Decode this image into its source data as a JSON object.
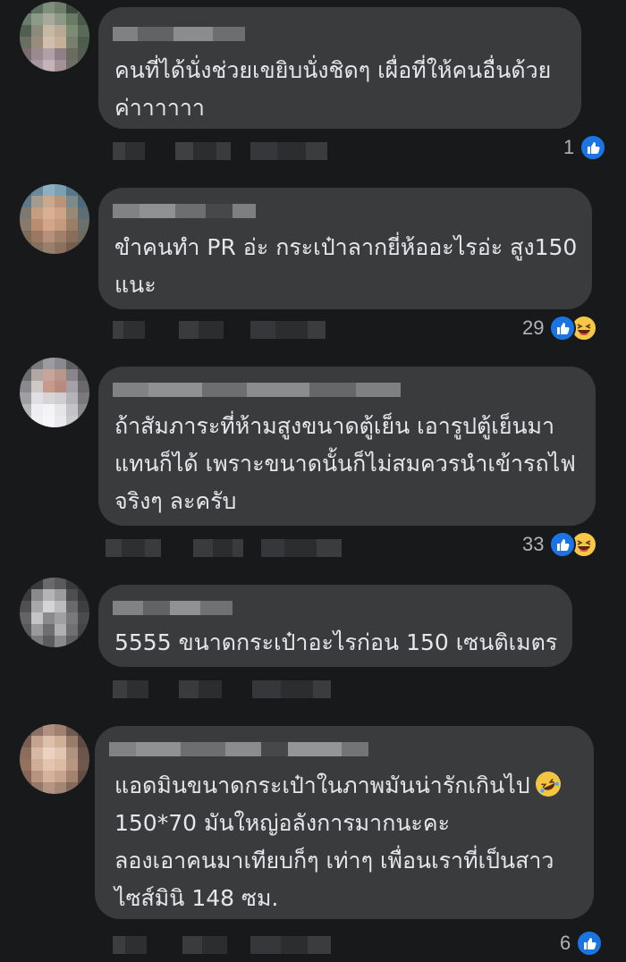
{
  "comments": [
    {
      "text": "คนที่ได้นั่งช่วยเขยิบนั่งชิดๆ เผื่อที่ให้คนอื่นด้วย\nค่าาาาาา",
      "reactions": "1",
      "reaction_icons": [
        "like-icon"
      ]
    },
    {
      "text": "ขำคนทำ PR อ่ะ กระเป๋าลากยี่ห้ออะไรอ่ะ สูง150\nแนะ",
      "reactions": "29",
      "reaction_icons": [
        "like-icon",
        "haha-icon"
      ]
    },
    {
      "text": "ถ้าสัมภาระที่ห้ามสูงขนาดตู้เย็น เอารูปตู้เย็นมา\nแทนก็ได้ เพราะขนาดนั้นก็ไม่สมควรนำเข้ารถไฟ\nจริงๆ ละครับ",
      "reactions": "33",
      "reaction_icons": [
        "like-icon",
        "haha-icon"
      ]
    },
    {
      "text": "5555 ขนาดกระเป๋าอะไรก่อน 150 เซนติเมตร",
      "reactions": "",
      "reaction_icons": []
    },
    {
      "text_line1": "แอดมินขนาดกระเป๋าในภาพมันน่ารักเกินไป",
      "text_rest": "150*70 มันใหญ่อลังการมากนะคะ\nลองเอาคนมาเทียบก็ๆ เท่าๆ เพื่อนเราที่เป็นสาว\nไซส์มินิ 148 ซม.",
      "inline_emoji": "rolling-on-floor-laughing-icon",
      "reactions": "6",
      "reaction_icons": [
        "like-icon"
      ]
    }
  ],
  "colors": {
    "background": "#18191a",
    "bubble": "#3a3b3c",
    "text": "#e4e6eb",
    "muted": "#b0b3b8",
    "like": "#1b74e4",
    "haha": "#f7c748"
  }
}
